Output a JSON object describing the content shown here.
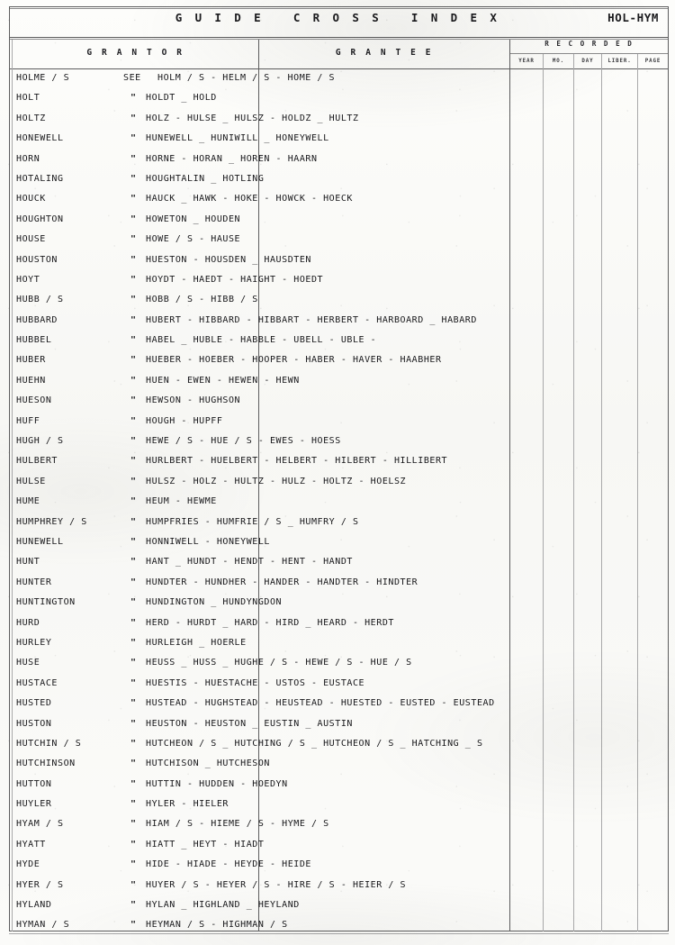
{
  "header": {
    "title": "G U I D E   C R O S S   I N D E X",
    "page_range": "HOL-HYM"
  },
  "columns": {
    "grantor": "G R A N T O R",
    "grantee": "G R A N T E E",
    "recorded": "R E C O R D E D",
    "recorded_sub": [
      "YEAR",
      "MO.",
      "DAY",
      "LIBER.",
      "PAGE"
    ]
  },
  "markers": {
    "see": "SEE",
    "ditto": "\""
  },
  "rows": [
    {
      "grantor": "HOLME / S",
      "lead": "SEE",
      "grantee": "HOLM / S - HELM / S - HOME / S"
    },
    {
      "grantor": "HOLT",
      "lead": "\"",
      "grantee": "HOLDT _ HOLD"
    },
    {
      "grantor": "HOLTZ",
      "lead": "\"",
      "grantee": "HOLZ - HULSE _ HULSZ - HOLDZ _ HULTZ"
    },
    {
      "grantor": "HONEWELL",
      "lead": "\"",
      "grantee": "HUNEWELL _ HUNIWILL _ HONEYWELL"
    },
    {
      "grantor": "HORN",
      "lead": "\"",
      "grantee": "HORNE - HORAN _ HOREN - HAARN"
    },
    {
      "grantor": "HOTALING",
      "lead": "\"",
      "grantee": "HOUGHTALIN _ HOTLING"
    },
    {
      "grantor": "HOUCK",
      "lead": "\"",
      "grantee": "HAUCK _ HAWK - HOKE - HOWCK - HOECK"
    },
    {
      "grantor": "HOUGHTON",
      "lead": "\"",
      "grantee": "HOWETON _ HOUDEN"
    },
    {
      "grantor": "HOUSE",
      "lead": "\"",
      "grantee": "HOWE / S - HAUSE"
    },
    {
      "grantor": "HOUSTON",
      "lead": "\"",
      "grantee": "HUESTON - HOUSDEN _ HAUSDTEN"
    },
    {
      "grantor": "HOYT",
      "lead": "\"",
      "grantee": "HOYDT - HAEDT - HAIGHT - HOEDT"
    },
    {
      "grantor": "HUBB / S",
      "lead": "\"",
      "grantee": "HOBB / S - HIBB / S"
    },
    {
      "grantor": "HUBBARD",
      "lead": "\"",
      "grantee": "HUBERT - HIBBARD - HIBBART - HERBERT - HARBOARD _ HABARD"
    },
    {
      "grantor": "HUBBEL",
      "lead": "\"",
      "grantee": "HABEL _ HUBLE - HABBLE - UBELL - UBLE -"
    },
    {
      "grantor": "HUBER",
      "lead": "\"",
      "grantee": "HUEBER - HOEBER - HOOPER - HABER - HAVER - HAABHER"
    },
    {
      "grantor": "HUEHN",
      "lead": "\"",
      "grantee": "HUEN - EWEN - HEWEN - HEWN"
    },
    {
      "grantor": "HUESON",
      "lead": "\"",
      "grantee": "HEWSON - HUGHSON"
    },
    {
      "grantor": "HUFF",
      "lead": "\"",
      "grantee": "HOUGH - HUPFF"
    },
    {
      "grantor": "HUGH / S",
      "lead": "\"",
      "grantee": "HEWE / S - HUE / S - EWES - HOESS"
    },
    {
      "grantor": "HULBERT",
      "lead": "\"",
      "grantee": "HURLBERT - HUELBERT - HELBERT - HILBERT - HILLIBERT"
    },
    {
      "grantor": "HULSE",
      "lead": "\"",
      "grantee": "HULSZ - HOLZ - HULTZ - HULZ - HOLTZ - HOELSZ"
    },
    {
      "grantor": "HUME",
      "lead": "\"",
      "grantee": "HEUM - HEWME"
    },
    {
      "grantor": "HUMPHREY / S",
      "lead": "\"",
      "grantee": "HUMPFRIES - HUMFRIE / S _ HUMFRY / S"
    },
    {
      "grantor": "HUNEWELL",
      "lead": "\"",
      "grantee": "HONNIWELL - HONEYWELL"
    },
    {
      "grantor": "HUNT",
      "lead": "\"",
      "grantee": "HANT _ HUNDT - HENDT - HENT - HANDT"
    },
    {
      "grantor": "HUNTER",
      "lead": "\"",
      "grantee": "HUNDTER - HUNDHER - HANDER - HANDTER - HINDTER"
    },
    {
      "grantor": "HUNTINGTON",
      "lead": "\"",
      "grantee": "HUNDINGTON _ HUNDYNGDON"
    },
    {
      "grantor": "HURD",
      "lead": "\"",
      "grantee": "HERD - HURDT _ HARD - HIRD _ HEARD - HERDT"
    },
    {
      "grantor": "HURLEY",
      "lead": "\"",
      "grantee": "HURLEIGH _ HOERLE"
    },
    {
      "grantor": "HUSE",
      "lead": "\"",
      "grantee": "HEUSS _ HUSS _ HUGHE / S - HEWE / S - HUE / S"
    },
    {
      "grantor": "HUSTACE",
      "lead": "\"",
      "grantee": "HUESTIS - HUESTACHE - USTOS - EUSTACE"
    },
    {
      "grantor": "HUSTED",
      "lead": "\"",
      "grantee": "HUSTEAD - HUGHSTEAD - HEUSTEAD - HUESTED - EUSTED - EUSTEAD"
    },
    {
      "grantor": "HUSTON",
      "lead": "\"",
      "grantee": "HEUSTON - HEUSTON _ EUSTIN _ AUSTIN"
    },
    {
      "grantor": "HUTCHIN / S",
      "lead": "\"",
      "grantee": "HUTCHEON / S _ HUTCHING / S _ HUTCHEON / S _ HATCHING _ S"
    },
    {
      "grantor": "HUTCHINSON",
      "lead": "\"",
      "grantee": "HUTCHISON _ HUTCHESON"
    },
    {
      "grantor": "HUTTON",
      "lead": "\"",
      "grantee": "HUTTIN - HUDDEN - HOEDYN"
    },
    {
      "grantor": "HUYLER",
      "lead": "\"",
      "grantee": "HYLER - HIELER"
    },
    {
      "grantor": "HYAM / S",
      "lead": "\"",
      "grantee": "HIAM / S - HIEME / S - HYME / S"
    },
    {
      "grantor": "HYATT",
      "lead": "\"",
      "grantee": "HIATT _ HEYT - HIADT"
    },
    {
      "grantor": "HYDE",
      "lead": "\"",
      "grantee": "HIDE - HIADE - HEYDE - HEIDE"
    },
    {
      "grantor": "HYER / S",
      "lead": "\"",
      "grantee": "HUYER / S - HEYER / S - HIRE / S - HEIER / S"
    },
    {
      "grantor": "HYLAND",
      "lead": "\"",
      "grantee": "HYLAN _ HIGHLAND _ HEYLAND"
    },
    {
      "grantor": "HYMAN / S",
      "lead": "\"",
      "grantee": "HEYMAN / S - HIGHMAN / S"
    }
  ]
}
